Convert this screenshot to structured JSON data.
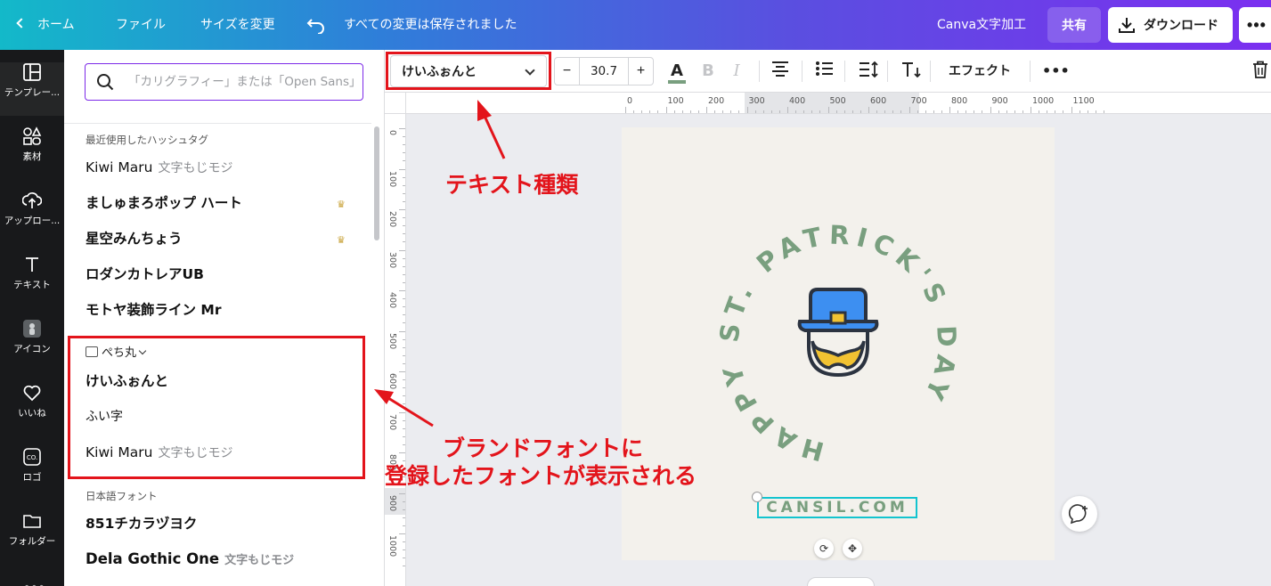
{
  "topbar": {
    "home": "ホーム",
    "file": "ファイル",
    "resize": "サイズを変更",
    "undo_icon": "undo-icon",
    "saved_status": "すべての変更は保存されました",
    "project_name": "Canva文字加工",
    "share": "共有",
    "download": "ダウンロード",
    "more": "•••"
  },
  "rail": {
    "items": [
      {
        "label": "テンプレー...",
        "icon": "template-icon"
      },
      {
        "label": "素材",
        "icon": "elements-icon"
      },
      {
        "label": "アップロー...",
        "icon": "upload-icon"
      },
      {
        "label": "テキスト",
        "icon": "text-icon"
      },
      {
        "label": "アイコン",
        "icon": "app-icon"
      },
      {
        "label": "いいね",
        "icon": "heart-icon"
      },
      {
        "label": "ロゴ",
        "icon": "logo-icon"
      },
      {
        "label": "フォルダー",
        "icon": "folder-icon"
      }
    ]
  },
  "panel": {
    "search_placeholder": "「カリグラフィー」または「Open Sans」",
    "recent_title": "最近使用したハッシュタグ",
    "recent_fonts": [
      {
        "name": "Kiwi Maru",
        "sample": "文字もじモジ",
        "premium": false
      },
      {
        "name": "ましゅまろポップ ハート",
        "sample": "",
        "premium": true
      },
      {
        "name": "星空みんちょう",
        "sample": "",
        "premium": true
      },
      {
        "name": "ロダンカトレアUB",
        "sample": "",
        "premium": false
      },
      {
        "name": "モトヤ装飾ライン Mr",
        "sample": "",
        "premium": false
      }
    ],
    "brand_title": "ぺち丸",
    "brand_fonts": [
      {
        "name": "けいふぉんと",
        "sample": ""
      },
      {
        "name": "ふい字",
        "sample": ""
      },
      {
        "name": "Kiwi Maru",
        "sample": "文字もじモジ"
      }
    ],
    "japanese_title": "日本語フォント",
    "japanese_fonts": [
      {
        "name": "851チカラヅヨク",
        "sample": ""
      },
      {
        "name": "Dela Gothic One",
        "sample": "文字もじモジ"
      }
    ]
  },
  "toolbar": {
    "font_name": "けいふぉんと",
    "font_size": "30.7",
    "minus": "−",
    "plus": "+",
    "color_letter": "A",
    "bold": "B",
    "italic": "I",
    "effects": "エフェクト",
    "more": "•••",
    "text_color": "#799f7f"
  },
  "ruler": {
    "h_labels": [
      "0",
      "100",
      "200",
      "300",
      "400",
      "500",
      "600",
      "700",
      "800",
      "900",
      "1000",
      "1100"
    ],
    "v_labels": [
      "0",
      "100",
      "200",
      "300",
      "400",
      "500",
      "600",
      "700",
      "800",
      "900",
      "1000"
    ]
  },
  "design": {
    "circle_text": "HAPPY ST. PATRICK'S DAY",
    "url_text": "CANSIL.COM",
    "colors": {
      "green": "#799f7f",
      "hat": "#3d8ff1",
      "beard": "#f1c232",
      "outline": "#2b3340",
      "bg": "#f3f1ec"
    }
  },
  "annotations": {
    "text_type": "テキスト種類",
    "brand_line1": "ブランドフォントに",
    "brand_line2": "登録したフォントが表示される",
    "color": "#e3141b"
  }
}
